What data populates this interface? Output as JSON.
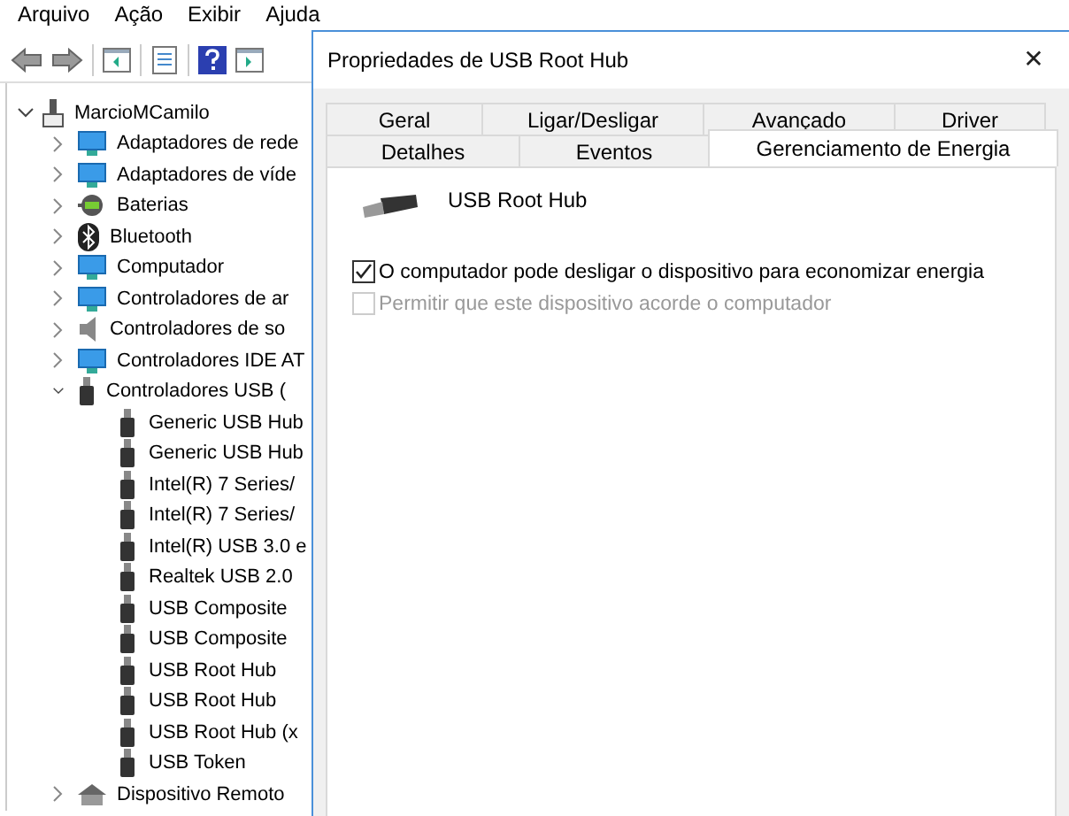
{
  "menu": [
    "Arquivo",
    "Ação",
    "Exibir",
    "Ajuda"
  ],
  "tree": {
    "label": "MarcioMCamilo",
    "expanded": true,
    "children": [
      {
        "label": "Adaptadores de rede",
        "expanded": false
      },
      {
        "label": "Adaptadores de víde",
        "expanded": false
      },
      {
        "label": "Baterias",
        "expanded": false
      },
      {
        "label": "Bluetooth",
        "expanded": false
      },
      {
        "label": "Computador",
        "expanded": false
      },
      {
        "label": "Controladores de ar",
        "expanded": false
      },
      {
        "label": "Controladores de so",
        "expanded": false
      },
      {
        "label": "Controladores IDE AT",
        "expanded": false
      },
      {
        "label": "Controladores USB (",
        "expanded": true,
        "children": [
          {
            "label": "Generic USB Hub"
          },
          {
            "label": "Generic USB Hub"
          },
          {
            "label": "Intel(R) 7 Series/"
          },
          {
            "label": "Intel(R) 7 Series/"
          },
          {
            "label": "Intel(R) USB 3.0 e"
          },
          {
            "label": "Realtek USB 2.0"
          },
          {
            "label": "USB Composite"
          },
          {
            "label": "USB Composite"
          },
          {
            "label": "USB Root Hub"
          },
          {
            "label": "USB Root Hub"
          },
          {
            "label": "USB Root Hub (x"
          },
          {
            "label": "USB Token"
          }
        ]
      },
      {
        "label": "Dispositivo Remoto",
        "expanded": false
      }
    ]
  },
  "dialog": {
    "title": "Propriedades de USB Root Hub",
    "close": "✕",
    "tab_rows": [
      [
        {
          "label": "Geral",
          "selected": false
        },
        {
          "label": "Ligar/Desligar",
          "selected": false
        },
        {
          "label": "Avançado",
          "selected": false
        },
        {
          "label": "Driver",
          "selected": false
        }
      ],
      [
        {
          "label": "Detalhes",
          "selected": false
        },
        {
          "label": "Eventos",
          "selected": false
        },
        {
          "label": "Gerenciamento de Energia",
          "selected": true
        }
      ]
    ],
    "device_name": "USB Root Hub",
    "options": [
      {
        "label": "O computador pode desligar o dispositivo para economizar energia",
        "checked": true,
        "disabled": false
      },
      {
        "label": "Permitir que este dispositivo acorde o computador",
        "checked": false,
        "disabled": true
      }
    ]
  }
}
